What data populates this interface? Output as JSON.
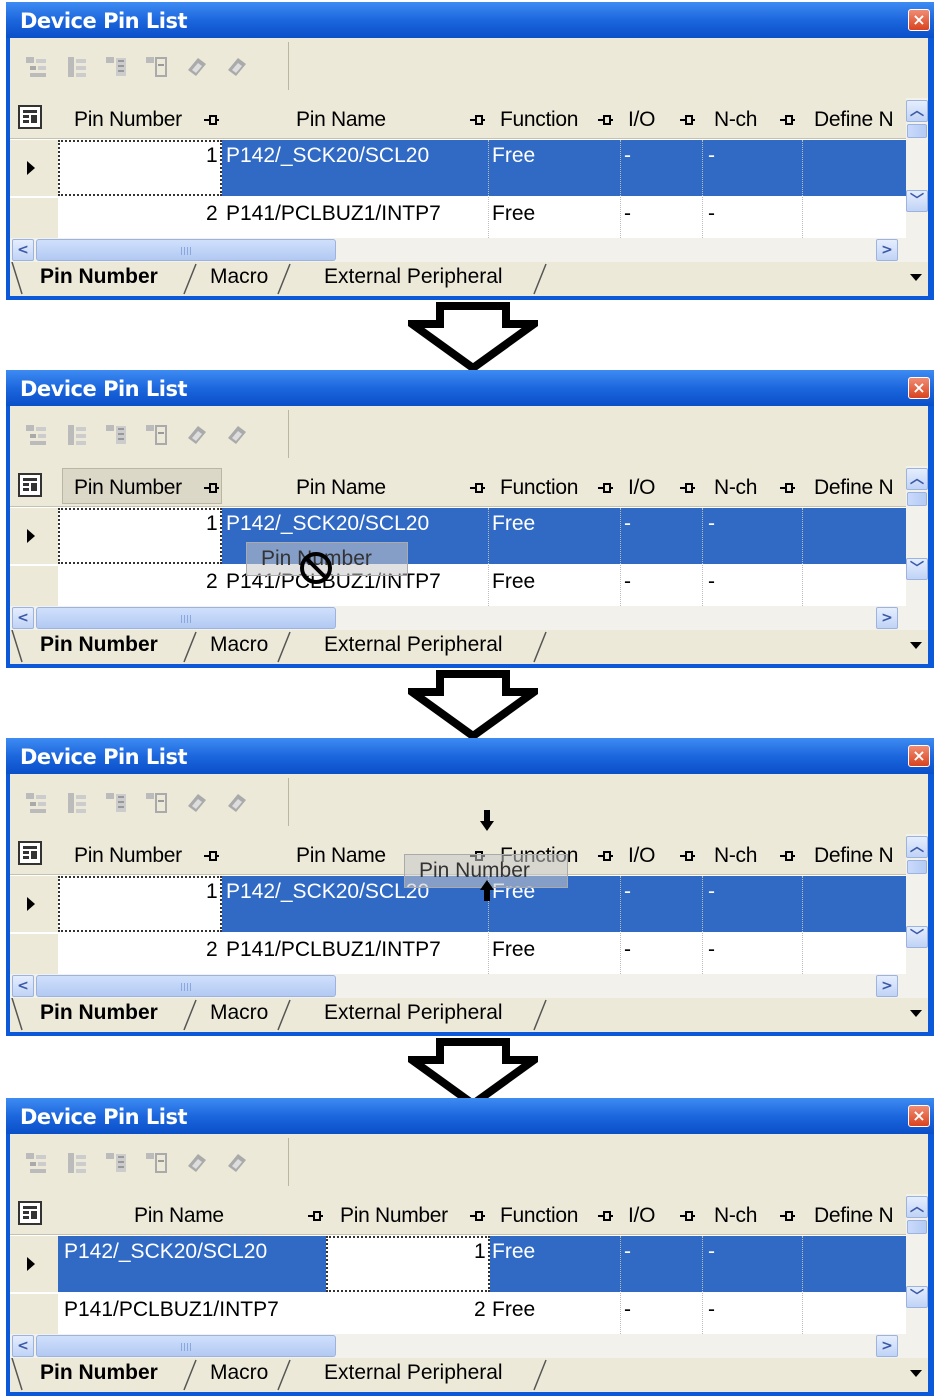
{
  "window_title": "Device Pin List",
  "close_icon_label": "×",
  "columns": {
    "pin_number": "Pin Number",
    "pin_name": "Pin Name",
    "function": "Function",
    "io": "I/O",
    "nch": "N-ch",
    "define": "Define N"
  },
  "rows": [
    {
      "pin_number": "1",
      "pin_name": "P142/_SCK20/SCL20",
      "function": "Free",
      "io": "-",
      "nch": "-"
    },
    {
      "pin_number": "2",
      "pin_name": "P141/PCLBUZ1/INTP7",
      "function": "Free",
      "io": "-",
      "nch": "-"
    }
  ],
  "tabs": [
    "Pin Number",
    "Macro",
    "External Peripheral"
  ],
  "active_tab": "Pin Number",
  "drag_ghost_label": "Pin Number",
  "toolbar_icons": [
    "tree-icon-1",
    "tree-icon-2",
    "tree-icon-3",
    "tree-icon-4",
    "chip-icon-1",
    "chip-icon-2"
  ],
  "states": [
    {
      "step": 1,
      "description_state": "initial",
      "column_order": [
        "pin_number",
        "pin_name"
      ]
    },
    {
      "step": 2,
      "description_state": "drag-start",
      "column_order": [
        "pin_number",
        "pin_name"
      ]
    },
    {
      "step": 3,
      "description_state": "drag-over-drop-target",
      "column_order": [
        "pin_number",
        "pin_name"
      ]
    },
    {
      "step": 4,
      "description_state": "dropped",
      "column_order": [
        "pin_name",
        "pin_number"
      ]
    }
  ]
}
